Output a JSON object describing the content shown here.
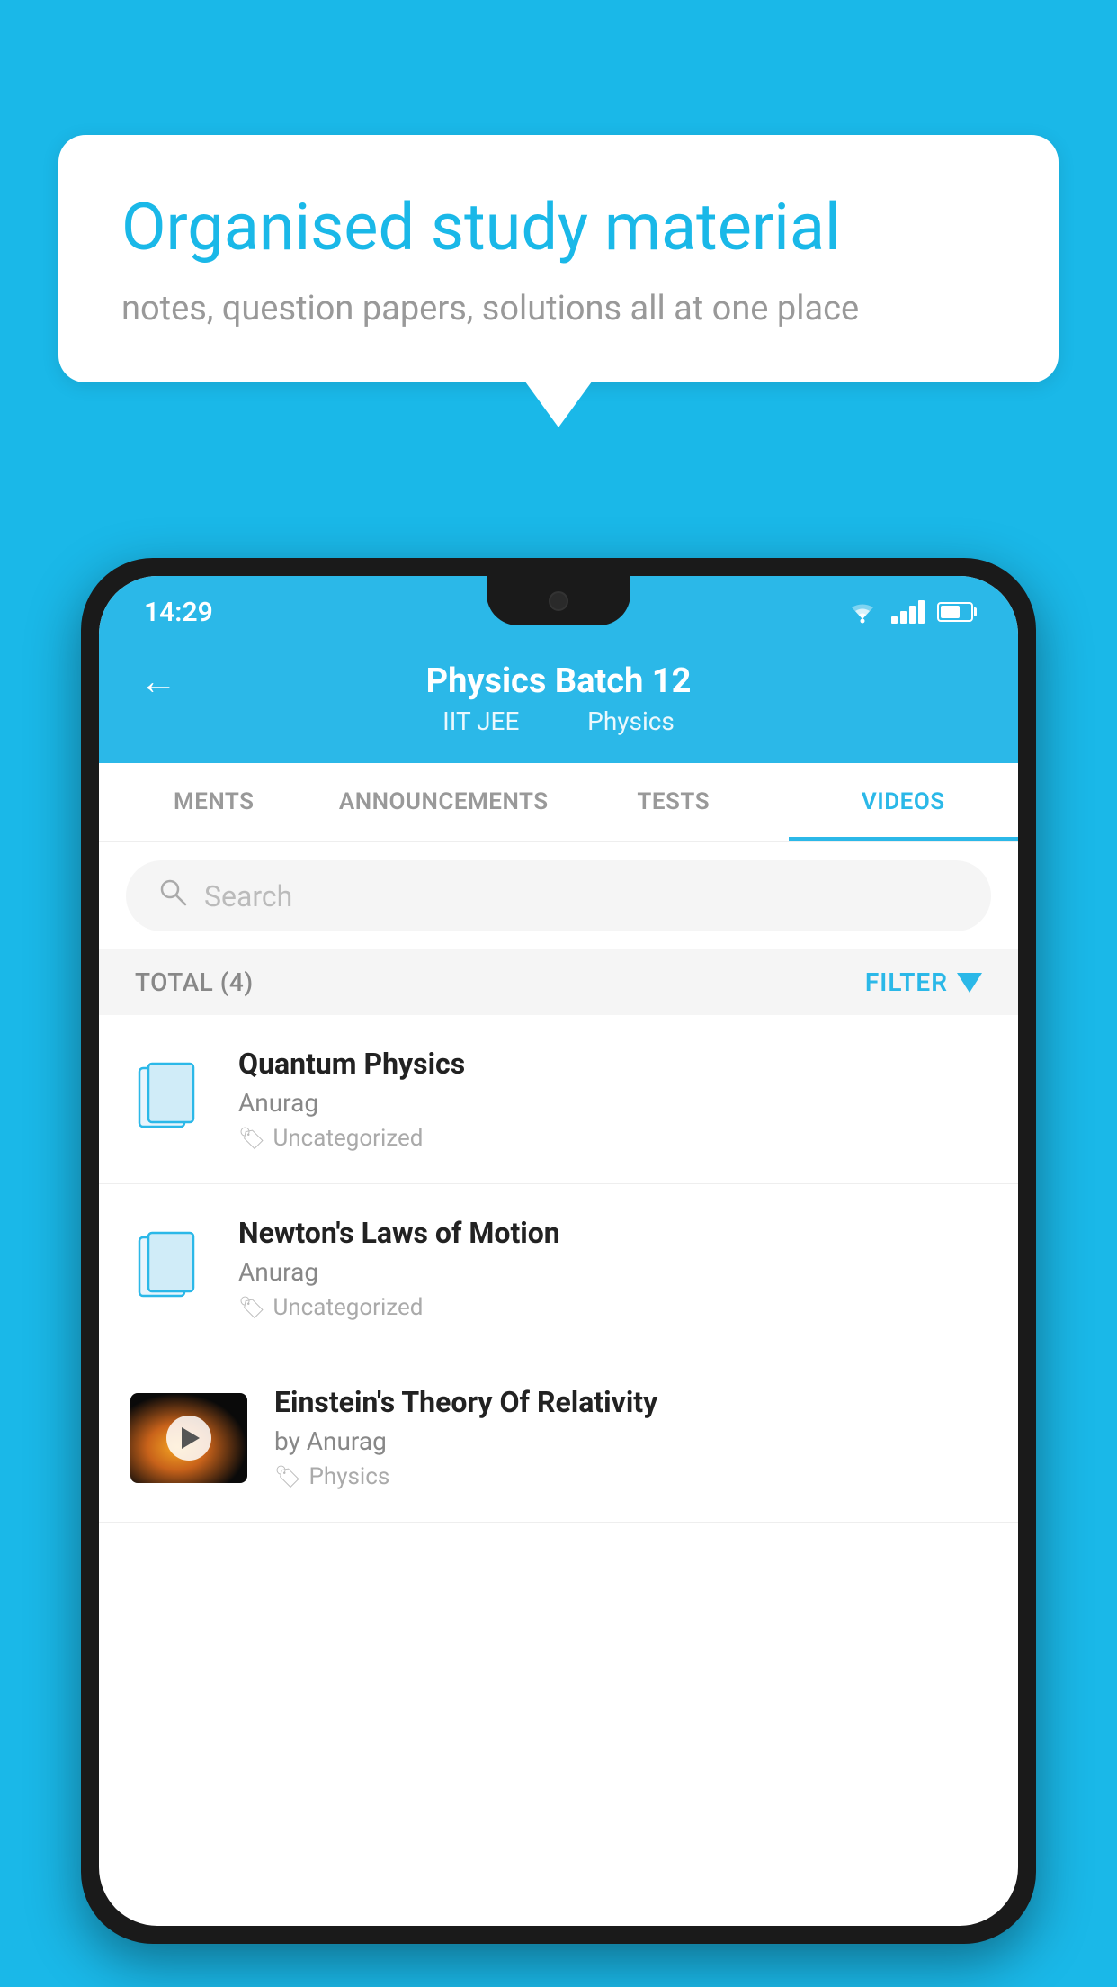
{
  "background": {
    "color": "#1ab8e8"
  },
  "promo": {
    "title": "Organised study material",
    "subtitle": "notes, question papers, solutions all at one place"
  },
  "status_bar": {
    "time": "14:29",
    "wifi": "wifi",
    "signal": "signal",
    "battery": "battery"
  },
  "app_header": {
    "back_label": "←",
    "title": "Physics Batch 12",
    "subtitle_part1": "IIT JEE",
    "subtitle_part2": "Physics"
  },
  "tabs": [
    {
      "label": "MENTS",
      "active": false
    },
    {
      "label": "ANNOUNCEMENTS",
      "active": false
    },
    {
      "label": "TESTS",
      "active": false
    },
    {
      "label": "VIDEOS",
      "active": true
    }
  ],
  "search": {
    "placeholder": "Search"
  },
  "list_header": {
    "total_label": "TOTAL (4)",
    "filter_label": "FILTER"
  },
  "videos": [
    {
      "title": "Quantum Physics",
      "author": "Anurag",
      "tag": "Uncategorized",
      "has_thumbnail": false
    },
    {
      "title": "Newton's Laws of Motion",
      "author": "Anurag",
      "tag": "Uncategorized",
      "has_thumbnail": false
    },
    {
      "title": "Einstein's Theory Of Relativity",
      "author": "by Anurag",
      "tag": "Physics",
      "has_thumbnail": true
    }
  ]
}
